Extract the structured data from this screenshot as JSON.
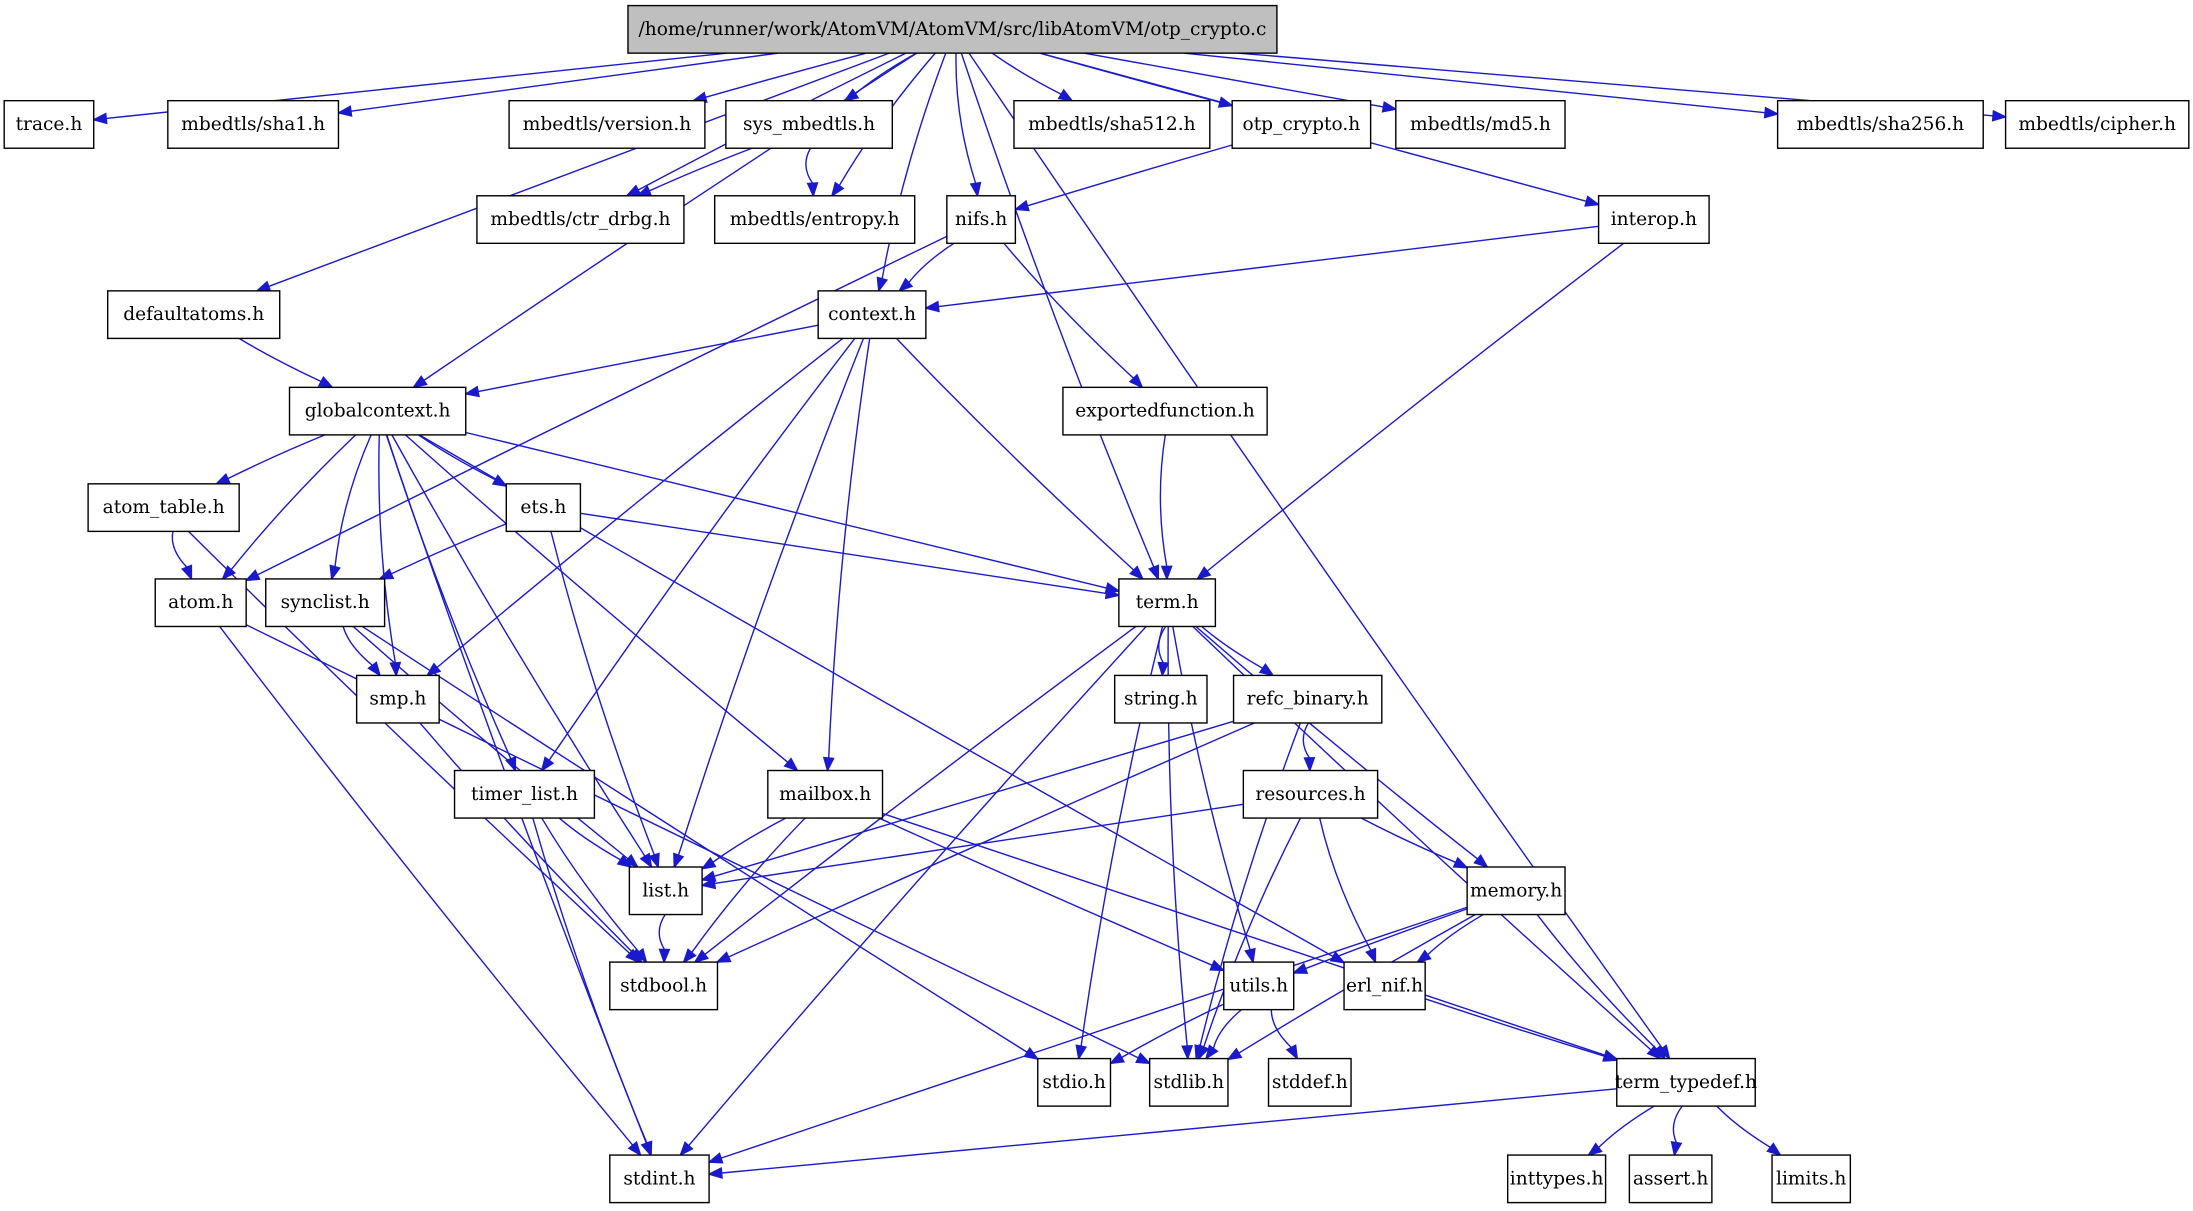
{
  "diagram": {
    "type": "include-dependency-graph",
    "root": "/home/runner/work/AtomVM/AtomVM/src/libAtomVM/otp_crypto.c",
    "colors": {
      "edge": "#1a1acc",
      "root_fill": "#bfbfbf",
      "node_fill": "#ffffff",
      "node_border": "#000000"
    },
    "nodes": [
      {
        "id": "root",
        "label": "/home/runner/work/AtomVM/AtomVM/src/libAtomVM/otp_crypto.c"
      },
      {
        "id": "trace",
        "label": "trace.h"
      },
      {
        "id": "sha1",
        "label": "mbedtls/sha1.h"
      },
      {
        "id": "version",
        "label": "mbedtls/version.h"
      },
      {
        "id": "sys_mbedtls",
        "label": "sys_mbedtls.h"
      },
      {
        "id": "sha512",
        "label": "mbedtls/sha512.h"
      },
      {
        "id": "otp_crypto_h",
        "label": "otp_crypto.h"
      },
      {
        "id": "md5",
        "label": "mbedtls/md5.h"
      },
      {
        "id": "sha256",
        "label": "mbedtls/sha256.h"
      },
      {
        "id": "cipher",
        "label": "mbedtls/cipher.h"
      },
      {
        "id": "ctr_drbg",
        "label": "mbedtls/ctr_drbg.h"
      },
      {
        "id": "entropy",
        "label": "mbedtls/entropy.h"
      },
      {
        "id": "nifs",
        "label": "nifs.h"
      },
      {
        "id": "interop",
        "label": "interop.h"
      },
      {
        "id": "defaultatoms",
        "label": "defaultatoms.h"
      },
      {
        "id": "context",
        "label": "context.h"
      },
      {
        "id": "globalcontext",
        "label": "globalcontext.h"
      },
      {
        "id": "exportedfunction",
        "label": "exportedfunction.h"
      },
      {
        "id": "atom_table",
        "label": "atom_table.h"
      },
      {
        "id": "ets",
        "label": "ets.h"
      },
      {
        "id": "term",
        "label": "term.h"
      },
      {
        "id": "atom",
        "label": "atom.h"
      },
      {
        "id": "synclist",
        "label": "synclist.h"
      },
      {
        "id": "smp",
        "label": "smp.h"
      },
      {
        "id": "string",
        "label": "string.h"
      },
      {
        "id": "refc_binary",
        "label": "refc_binary.h"
      },
      {
        "id": "timer_list",
        "label": "timer_list.h"
      },
      {
        "id": "mailbox",
        "label": "mailbox.h"
      },
      {
        "id": "resources",
        "label": "resources.h"
      },
      {
        "id": "list",
        "label": "list.h"
      },
      {
        "id": "memory",
        "label": "memory.h"
      },
      {
        "id": "stdbool",
        "label": "stdbool.h"
      },
      {
        "id": "utils",
        "label": "utils.h"
      },
      {
        "id": "erl_nif",
        "label": "erl_nif.h"
      },
      {
        "id": "stdio",
        "label": "stdio.h"
      },
      {
        "id": "stdlib",
        "label": "stdlib.h"
      },
      {
        "id": "stddef",
        "label": "stddef.h"
      },
      {
        "id": "term_typedef",
        "label": "term_typedef.h"
      },
      {
        "id": "stdint",
        "label": "stdint.h"
      },
      {
        "id": "inttypes",
        "label": "inttypes.h"
      },
      {
        "id": "assert",
        "label": "assert.h"
      },
      {
        "id": "limits",
        "label": "limits.h"
      }
    ],
    "edges": [
      [
        "root",
        "trace"
      ],
      [
        "root",
        "sha1"
      ],
      [
        "root",
        "version"
      ],
      [
        "root",
        "sys_mbedtls"
      ],
      [
        "root",
        "sha512"
      ],
      [
        "root",
        "otp_crypto_h"
      ],
      [
        "root",
        "md5"
      ],
      [
        "root",
        "sha256"
      ],
      [
        "root",
        "cipher"
      ],
      [
        "root",
        "ctr_drbg"
      ],
      [
        "root",
        "entropy"
      ],
      [
        "root",
        "nifs"
      ],
      [
        "root",
        "interop"
      ],
      [
        "root",
        "defaultatoms"
      ],
      [
        "root",
        "context"
      ],
      [
        "root",
        "globalcontext"
      ],
      [
        "root",
        "term"
      ],
      [
        "root",
        "term_typedef"
      ],
      [
        "sys_mbedtls",
        "ctr_drbg"
      ],
      [
        "sys_mbedtls",
        "entropy"
      ],
      [
        "otp_crypto_h",
        "nifs"
      ],
      [
        "nifs",
        "context"
      ],
      [
        "nifs",
        "atom"
      ],
      [
        "nifs",
        "exportedfunction"
      ],
      [
        "interop",
        "context"
      ],
      [
        "interop",
        "term"
      ],
      [
        "defaultatoms",
        "globalcontext"
      ],
      [
        "context",
        "globalcontext"
      ],
      [
        "context",
        "term"
      ],
      [
        "context",
        "smp"
      ],
      [
        "context",
        "list"
      ],
      [
        "context",
        "timer_list"
      ],
      [
        "context",
        "mailbox"
      ],
      [
        "exportedfunction",
        "term"
      ],
      [
        "globalcontext",
        "atom_table"
      ],
      [
        "globalcontext",
        "atom"
      ],
      [
        "globalcontext",
        "synclist"
      ],
      [
        "globalcontext",
        "smp"
      ],
      [
        "globalcontext",
        "timer_list"
      ],
      [
        "globalcontext",
        "ets"
      ],
      [
        "globalcontext",
        "list"
      ],
      [
        "globalcontext",
        "mailbox"
      ],
      [
        "globalcontext",
        "term"
      ],
      [
        "globalcontext",
        "erl_nif"
      ],
      [
        "globalcontext",
        "stdint"
      ],
      [
        "atom_table",
        "atom"
      ],
      [
        "atom_table",
        "stdbool"
      ],
      [
        "ets",
        "synclist"
      ],
      [
        "ets",
        "list"
      ],
      [
        "ets",
        "term"
      ],
      [
        "atom",
        "stdint"
      ],
      [
        "atom",
        "stdlib"
      ],
      [
        "synclist",
        "smp"
      ],
      [
        "synclist",
        "list"
      ],
      [
        "synclist",
        "stdio"
      ],
      [
        "smp",
        "stdbool"
      ],
      [
        "term",
        "string"
      ],
      [
        "term",
        "refc_binary"
      ],
      [
        "term",
        "memory"
      ],
      [
        "term",
        "utils"
      ],
      [
        "term",
        "stdbool"
      ],
      [
        "term",
        "stdint"
      ],
      [
        "term",
        "stdio"
      ],
      [
        "term",
        "stdlib"
      ],
      [
        "term",
        "term_typedef"
      ],
      [
        "refc_binary",
        "resources"
      ],
      [
        "refc_binary",
        "list"
      ],
      [
        "refc_binary",
        "stdbool"
      ],
      [
        "refc_binary",
        "stdlib"
      ],
      [
        "timer_list",
        "list"
      ],
      [
        "timer_list",
        "stdbool"
      ],
      [
        "timer_list",
        "stdint"
      ],
      [
        "mailbox",
        "list"
      ],
      [
        "mailbox",
        "stdbool"
      ],
      [
        "mailbox",
        "utils"
      ],
      [
        "mailbox",
        "term_typedef"
      ],
      [
        "resources",
        "list"
      ],
      [
        "resources",
        "memory"
      ],
      [
        "resources",
        "erl_nif"
      ],
      [
        "resources",
        "stdlib"
      ],
      [
        "list",
        "stdbool"
      ],
      [
        "memory",
        "utils"
      ],
      [
        "memory",
        "erl_nif"
      ],
      [
        "memory",
        "term_typedef"
      ],
      [
        "memory",
        "stdlib"
      ],
      [
        "memory",
        "stdint"
      ],
      [
        "utils",
        "stdio"
      ],
      [
        "utils",
        "stdlib"
      ],
      [
        "utils",
        "stddef"
      ],
      [
        "erl_nif",
        "term_typedef"
      ],
      [
        "term_typedef",
        "stdint"
      ],
      [
        "term_typedef",
        "inttypes"
      ],
      [
        "term_typedef",
        "assert"
      ],
      [
        "term_typedef",
        "limits"
      ]
    ]
  }
}
